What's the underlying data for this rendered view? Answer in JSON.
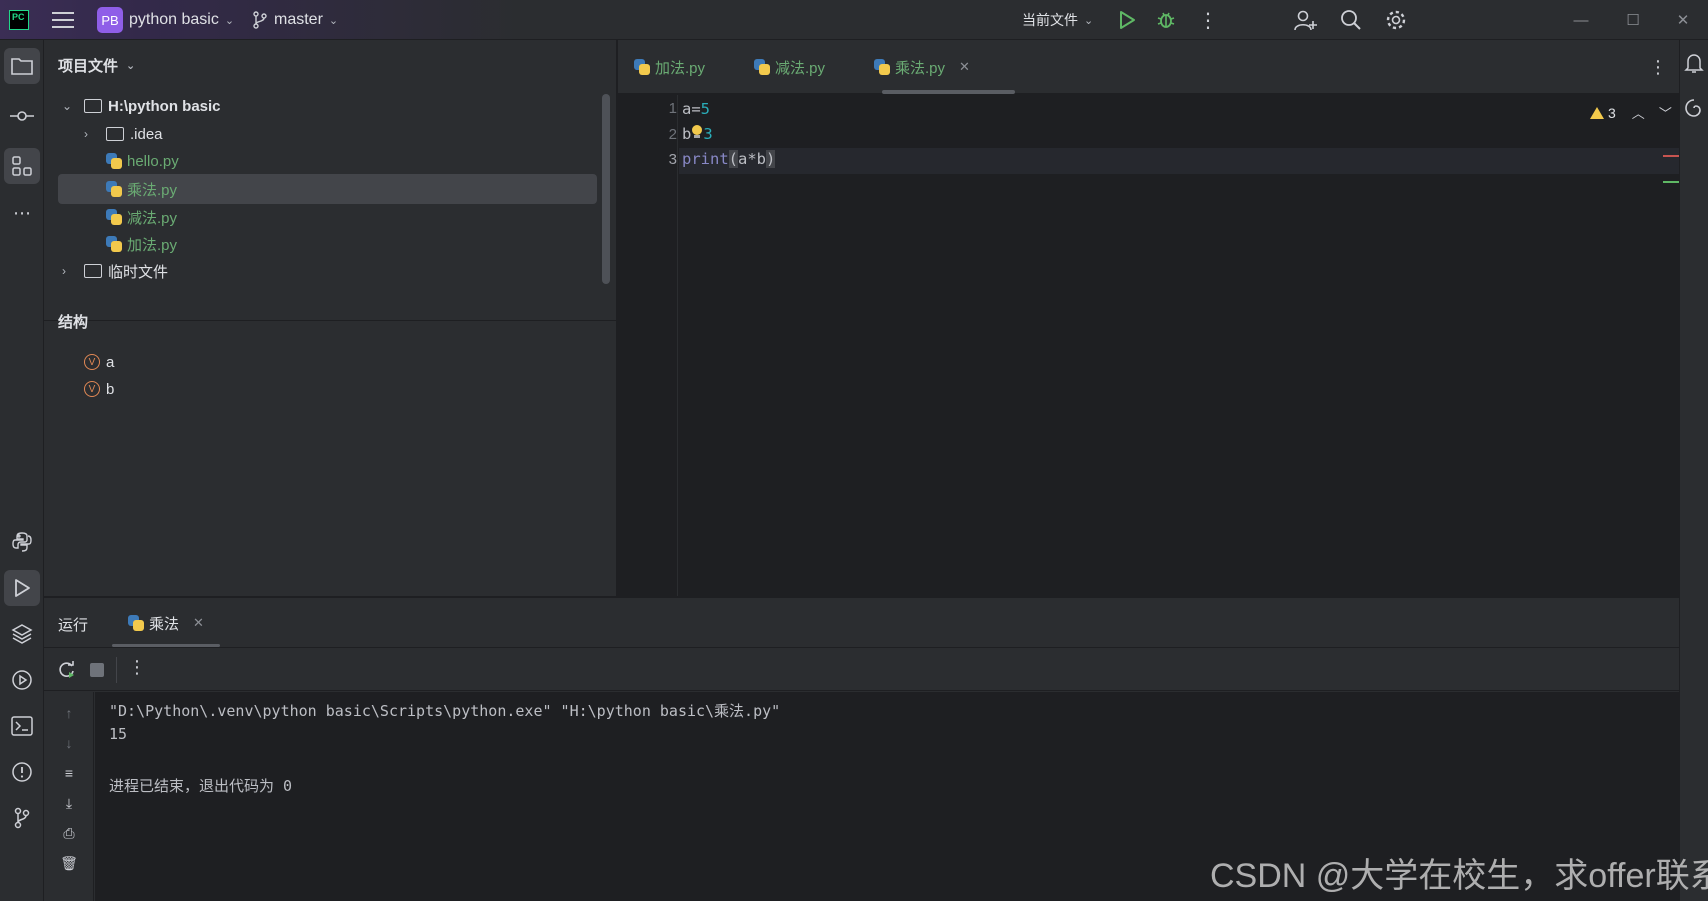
{
  "titlebar": {
    "app_logo": "pycharm-logo",
    "project_badge": "PB",
    "project_name": "python basic",
    "branch": "master",
    "run_config": "当前文件"
  },
  "project_panel": {
    "title": "项目文件",
    "tree": [
      {
        "label": "H:\\python basic",
        "type": "folder",
        "expanded": true,
        "depth": 0
      },
      {
        "label": ".idea",
        "type": "folder",
        "expanded": false,
        "depth": 1
      },
      {
        "label": "hello.py",
        "type": "py",
        "depth": 2
      },
      {
        "label": "乘法.py",
        "type": "py",
        "depth": 2,
        "selected": true
      },
      {
        "label": "减法.py",
        "type": "py",
        "depth": 2
      },
      {
        "label": "加法.py",
        "type": "py",
        "depth": 2
      },
      {
        "label": "临时文件",
        "type": "folder",
        "expanded": false,
        "depth": 0
      }
    ]
  },
  "structure_panel": {
    "title": "结构",
    "items": [
      {
        "badge": "V",
        "label": "a"
      },
      {
        "badge": "V",
        "label": "b"
      }
    ]
  },
  "editor": {
    "tabs": [
      {
        "label": "加法.py",
        "active": false
      },
      {
        "label": "减法.py",
        "active": false
      },
      {
        "label": "乘法.py",
        "active": true
      }
    ],
    "line_numbers": [
      "1",
      "2",
      "3"
    ],
    "lines": [
      "a=5",
      "b=3",
      "print(a*b)"
    ],
    "warning_count": "3"
  },
  "run_panel": {
    "title": "运行",
    "tab_label": "乘法",
    "output": [
      "\"D:\\Python\\.venv\\python basic\\Scripts\\python.exe\" \"H:\\python basic\\乘法.py\"",
      "15",
      "",
      "进程已结束，退出代码为 0"
    ]
  },
  "watermark": "CSDN @大学在校生，求offer联系",
  "colors": {
    "background": "#1e1f22",
    "panel": "#2b2d30",
    "accent_green": "#6aab73",
    "number": "#2aacb8",
    "builtin": "#8888c6"
  }
}
